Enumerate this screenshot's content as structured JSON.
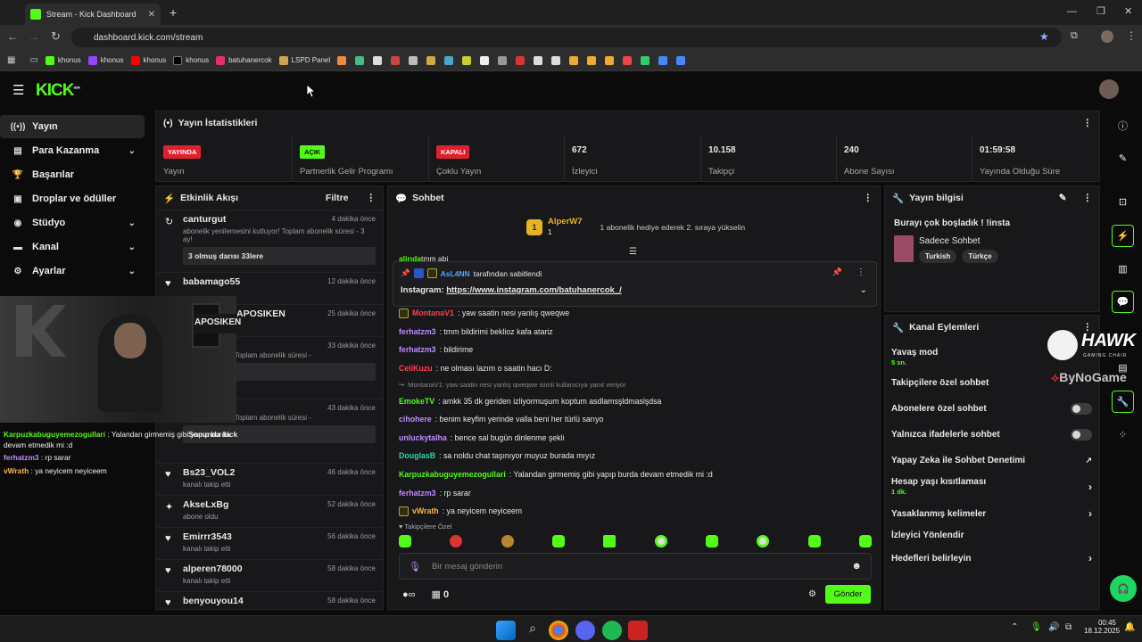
{
  "browser": {
    "tab_title": "Stream - Kick Dashboard",
    "url": "dashboard.kick.com/stream",
    "bookmarks": [
      "khonus",
      "khonus",
      "khonus",
      "khonus",
      "batuhanercok",
      "LSPD Panel"
    ]
  },
  "brand": {
    "logo": "KICK",
    "beta": "BETA",
    "accent": "#53fc18"
  },
  "sidebar": {
    "items": [
      {
        "label": "Yayın",
        "icon": "broadcast-icon",
        "active": true
      },
      {
        "label": "Para Kazanma",
        "icon": "money-icon"
      },
      {
        "label": "Başarılar",
        "icon": "trophy-icon"
      },
      {
        "label": "Droplar ve ödüller",
        "icon": "gift-icon"
      },
      {
        "label": "Stüdyo",
        "icon": "studio-icon"
      },
      {
        "label": "Kanal",
        "icon": "channel-icon"
      },
      {
        "label": "Ayarlar",
        "icon": "gear-icon"
      }
    ]
  },
  "overlay_chat": [
    {
      "user": "Karpuzkabuguyemezogullari",
      "text": " : Yalandan girmemiş gibi yapıp burda devam etmedik mi :d"
    },
    {
      "user": "ferhatzm3",
      "text": " : rp sarar"
    },
    {
      "user": "vWrath",
      "text": " : ya neyicem neyiceem"
    }
  ],
  "stats": {
    "title": "Yayın İstatistikleri",
    "items": [
      {
        "badge": "YAYINDA",
        "label": "Yayın"
      },
      {
        "badge": "AÇIK",
        "label": "Partnerlik Gelir Programı"
      },
      {
        "badge": "KAPALI",
        "label": "Çoklu Yayın"
      },
      {
        "value": "672",
        "label": "İzleyici"
      },
      {
        "value": "10.158",
        "label": "Takipçi"
      },
      {
        "value": "240",
        "label": "Abone Sayısı"
      },
      {
        "value": "01:59:58",
        "label": "Yayında Olduğu Süre"
      }
    ]
  },
  "activity": {
    "title": "Etkinlik Akışı",
    "filter": "Filtre",
    "items": [
      {
        "name": "canturgut",
        "time": "4 dakika önce",
        "desc": "abonelik yenilemesini kutluyor! Toplam abonelik süresi - 3 ay!",
        "quote": "3 olmuş darısı 33lere"
      },
      {
        "name": "babamago55",
        "time": "12 dakika önce",
        "desc": ""
      },
      {
        "name": "APOSIKEN",
        "time": "25 dakika önce",
        "desc": ""
      },
      {
        "name": "",
        "time": "33 dakika önce",
        "desc": "mesini kutluyor! Toplam abonelik süresi -",
        "quote": "u"
      },
      {
        "name": "",
        "time": "43 dakika önce",
        "desc": "mesini kutluyor! Toplam abonelik süresi -",
        "quote": "Sonunda kick"
      },
      {
        "name": "Bs23_VOL2",
        "time": "46 dakika önce",
        "desc": "kanalı takip etti"
      },
      {
        "name": "AkseLxBg",
        "time": "52 dakika önce",
        "desc": "abone oldu"
      },
      {
        "name": "Emirrr3543",
        "time": "56 dakika önce",
        "desc": "kanalı takip etti"
      },
      {
        "name": "alperen78000",
        "time": "58 dakika önce",
        "desc": "kanalı takip etti"
      },
      {
        "name": "benyouyou14",
        "time": "58 dakika önce",
        "desc": ""
      }
    ]
  },
  "chat": {
    "title": "Sohbet",
    "gifter": {
      "name": "AlperW7",
      "rank": "1",
      "count": "1",
      "text": "1 abonelik hediye ederek 2. sıraya yükselin"
    },
    "cut_message": {
      "user": "alirıda",
      "text": "tmm abi"
    },
    "pinned": {
      "by": "AsL4NN",
      "by_text": "tarafından sabitlendi",
      "label": "Instagram:",
      "link": "https://www.instagram.com/batuhanercok_/"
    },
    "messages": [
      {
        "user": "MontanaV1",
        "color": "#ff3f4f",
        "text": ": yaw saatin nesi yanlış qweqwe",
        "badge": true
      },
      {
        "user": "ferhatzm3",
        "color": "#c08bff",
        "text": ": tmm bildirimi beklioz kafa atariz"
      },
      {
        "user": "ferhatzm3",
        "color": "#c08bff",
        "text": ": bildirime"
      },
      {
        "user": "CeliKuzu",
        "color": "#ff3f4f",
        "text": ": ne olması lazım o saatin hacı D:"
      },
      {
        "reply": "MontanaV1: yaw saatin nesi yanlış qweqwe isimli kullanıcıya yanıt veriyor"
      },
      {
        "user": "EmokeTV",
        "color": "#53fc18",
        "text": ": amkk 35 dk geriden izliyormuşum koptum asdlamsşldmaslşdsa"
      },
      {
        "user": "cihohere",
        "color": "#c08bff",
        "text": ": benim keyfim yerinde valla beni her türlü sarıyo"
      },
      {
        "user": "unluckytalha",
        "color": "#c08bff",
        "text": ": bence sal bugün dinlenme şekli"
      },
      {
        "user": "DouglasB",
        "color": "#2bd6a1",
        "text": ": sa noldu chat taşınıyor muyuz burada mıyız"
      },
      {
        "user": "Karpuzkabuguyemezogullari",
        "color": "#53fc18",
        "text": ": Yalandan girmemiş gibi yapıp burda devam etmedik mi :d"
      },
      {
        "user": "ferhatzm3",
        "color": "#c08bff",
        "text": ": rp sarar"
      },
      {
        "user": "vWrath",
        "color": "#ffb347",
        "text": ": ya neyicem neyiceem",
        "badge": true
      }
    ],
    "followers_only": "Takipçilere Özel",
    "placeholder": "Bir mesaj gönderin",
    "points": "0",
    "send": "Gönder"
  },
  "stream_info": {
    "title": "Yayın bilgisi",
    "stream_title": "Burayı çok boşladık ! !insta",
    "category": "Sadece Sohbet",
    "tags": [
      "Turkish",
      "Türkçe"
    ]
  },
  "channel_actions": {
    "title": "Kanal Eylemleri",
    "slow_mode": "Yavaş mod",
    "slow_value": "5 sn.",
    "followers_chat": "Takipçilere özel sohbet",
    "subs_chat": "Abonelere özel sohbet",
    "emote_chat": "Yalnızca ifadelerle sohbet",
    "ai_moderation": "Yapay Zeka ile Sohbet Denetimi",
    "account_age": "Hesap yaşı kısıtlaması",
    "account_age_value": "1 dk.",
    "banned_words": "Yasaklanmış kelimeler",
    "viewer_redirect": "İzleyici Yönlendir",
    "goals": "Hedefleri belirleyin",
    "sponsor": "HAWK",
    "sponsor_sub": "GAMING CHAIR",
    "sponsor2": "ByNoGame"
  },
  "taskbar": {
    "time": "00:45",
    "date": "18.12.2025"
  }
}
